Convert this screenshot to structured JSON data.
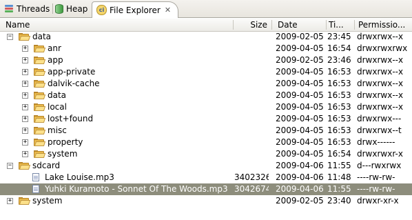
{
  "tabs": [
    {
      "label": "Threads",
      "icon": "threads-icon"
    },
    {
      "label": "Heap",
      "icon": "heap-icon"
    },
    {
      "label": "File Explorer",
      "icon": "file-explorer-icon",
      "active": true
    }
  ],
  "header": {
    "name": "Name",
    "size": "Size",
    "date": "Date",
    "time": "Ti...",
    "permissions": "Permissio..."
  },
  "rows": [
    {
      "depth": 0,
      "type": "folder",
      "toggle": "−",
      "name": "data",
      "size": "",
      "date": "2009-02-05",
      "time": "23:45",
      "perm": "drwxrwx--x"
    },
    {
      "depth": 1,
      "type": "folder",
      "toggle": "+",
      "name": "anr",
      "size": "",
      "date": "2009-04-05",
      "time": "16:54",
      "perm": "drwxrwxrwx"
    },
    {
      "depth": 1,
      "type": "folder",
      "toggle": "+",
      "name": "app",
      "size": "",
      "date": "2009-02-05",
      "time": "23:46",
      "perm": "drwxrwx--x"
    },
    {
      "depth": 1,
      "type": "folder",
      "toggle": "+",
      "name": "app-private",
      "size": "",
      "date": "2009-04-05",
      "time": "16:53",
      "perm": "drwxrwx--x"
    },
    {
      "depth": 1,
      "type": "folder",
      "toggle": "+",
      "name": "dalvik-cache",
      "size": "",
      "date": "2009-04-05",
      "time": "16:53",
      "perm": "drwxrwx--x"
    },
    {
      "depth": 1,
      "type": "folder",
      "toggle": "+",
      "name": "data",
      "size": "",
      "date": "2009-04-05",
      "time": "16:53",
      "perm": "drwxrwx--x"
    },
    {
      "depth": 1,
      "type": "folder",
      "toggle": "+",
      "name": "local",
      "size": "",
      "date": "2009-04-05",
      "time": "16:53",
      "perm": "drwxrwx--x"
    },
    {
      "depth": 1,
      "type": "folder",
      "toggle": "+",
      "name": "lost+found",
      "size": "",
      "date": "2009-04-05",
      "time": "16:53",
      "perm": "drwxrwx---"
    },
    {
      "depth": 1,
      "type": "folder",
      "toggle": "+",
      "name": "misc",
      "size": "",
      "date": "2009-04-05",
      "time": "16:53",
      "perm": "drwxrwx--t"
    },
    {
      "depth": 1,
      "type": "folder",
      "toggle": "+",
      "name": "property",
      "size": "",
      "date": "2009-04-05",
      "time": "16:53",
      "perm": "drwx------"
    },
    {
      "depth": 1,
      "type": "folder",
      "toggle": "+",
      "name": "system",
      "size": "",
      "date": "2009-04-05",
      "time": "16:54",
      "perm": "drwxrwxr-x"
    },
    {
      "depth": 0,
      "type": "folder",
      "toggle": "−",
      "name": "sdcard",
      "size": "",
      "date": "2009-04-06",
      "time": "11:55",
      "perm": "d---rwxrwx"
    },
    {
      "depth": 1,
      "type": "file",
      "toggle": "",
      "name": "Lake Louise.mp3",
      "size": "3402326",
      "date": "2009-04-06",
      "time": "11:48",
      "perm": "----rw-rw-"
    },
    {
      "depth": 1,
      "type": "file",
      "toggle": "",
      "name": "Yuhki Kuramoto - Sonnet Of The Woods.mp3",
      "size": "3042674",
      "date": "2009-04-06",
      "time": "11:55",
      "perm": "----rw-rw-",
      "selected": true
    },
    {
      "depth": 0,
      "type": "folder",
      "toggle": "+",
      "name": "system",
      "size": "",
      "date": "2009-02-05",
      "time": "23:40",
      "perm": "drwxr-xr-x"
    }
  ],
  "colors": {
    "selection": "#8d8d7c",
    "folder": "#e8b84a",
    "tabbar": "#ecebe6"
  }
}
